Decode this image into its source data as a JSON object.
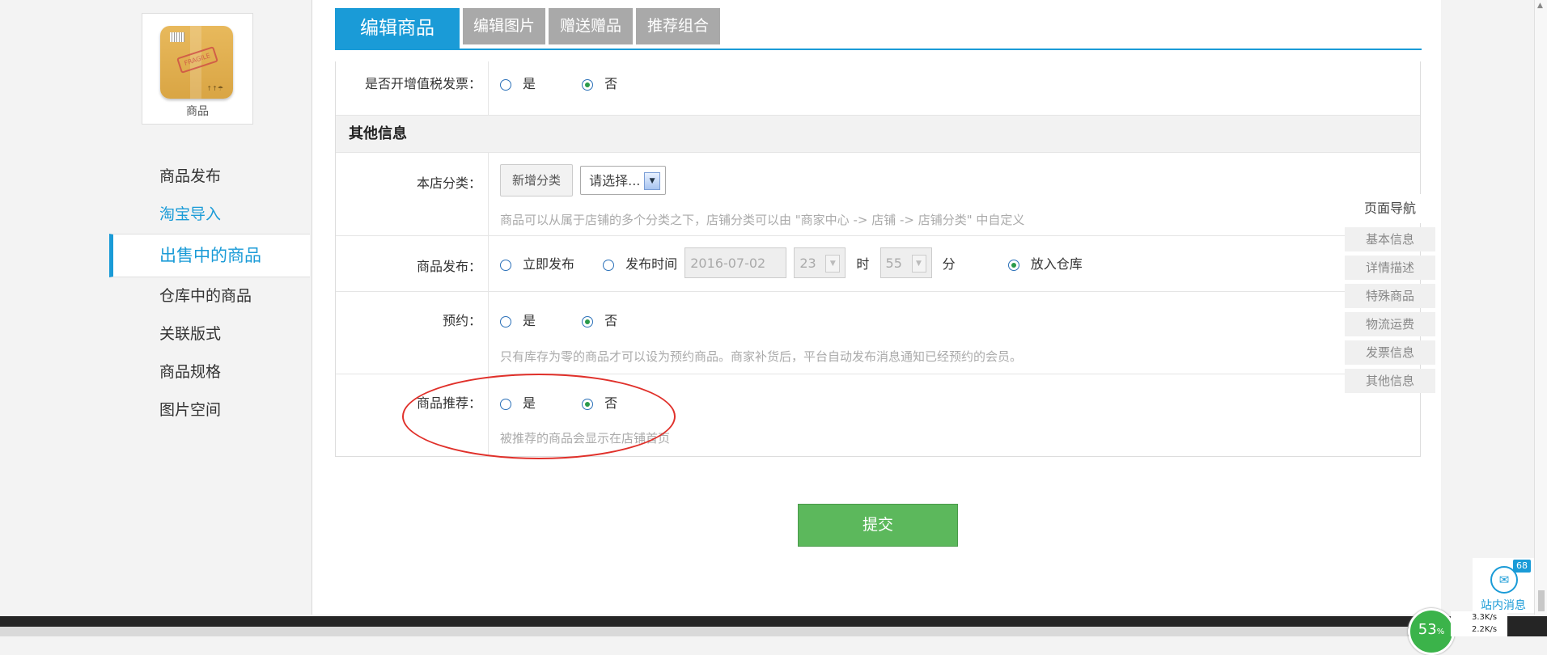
{
  "sidebar": {
    "app_label": "商品",
    "items": [
      {
        "label": "商品发布"
      },
      {
        "label": "淘宝导入"
      },
      {
        "label": "出售中的商品"
      },
      {
        "label": "仓库中的商品"
      },
      {
        "label": "关联版式"
      },
      {
        "label": "商品规格"
      },
      {
        "label": "图片空间"
      }
    ]
  },
  "tabs": [
    {
      "label": "编辑商品"
    },
    {
      "label": "编辑图片"
    },
    {
      "label": "赠送赠品"
    },
    {
      "label": "推荐组合"
    }
  ],
  "form": {
    "vat_invoice": {
      "label": "是否开增值税发票：",
      "yes": "是",
      "no": "否",
      "selected": "否"
    },
    "section_title": "其他信息",
    "store_category": {
      "label": "本店分类：",
      "add_button": "新增分类",
      "select_value": "请选择...",
      "hint": "商品可以从属于店铺的多个分类之下，店铺分类可以由 \"商家中心 -> 店铺 -> 店铺分类\" 中自定义"
    },
    "publish": {
      "label": "商品发布：",
      "option_now": "立即发布",
      "option_time": "发布时间",
      "date_value": "2016-07-02",
      "hour_value": "23",
      "hour_unit": "时",
      "minute_value": "55",
      "minute_unit": "分",
      "option_store": "放入仓库",
      "selected": "放入仓库"
    },
    "reservation": {
      "label": "预约：",
      "yes": "是",
      "no": "否",
      "selected": "否",
      "hint": "只有库存为零的商品才可以设为预约商品。商家补货后，平台自动发布消息通知已经预约的会员。"
    },
    "recommend": {
      "label": "商品推荐：",
      "yes": "是",
      "no": "否",
      "selected": "否",
      "hint": "被推荐的商品会显示在店铺首页"
    },
    "submit": "提交"
  },
  "page_nav": {
    "title": "页面导航",
    "items": [
      "基本信息",
      "详情描述",
      "特殊商品",
      "物流运费",
      "发票信息",
      "其他信息"
    ]
  },
  "messages": {
    "badge": "68",
    "label": "站内消息"
  },
  "system": {
    "cpu_percent": "53",
    "up_speed": "3.3K/s",
    "down_speed": "2.2K/s"
  },
  "colors": {
    "accent": "#1a9bd7",
    "submit": "#5cb85c",
    "annotation": "#e0302a"
  }
}
